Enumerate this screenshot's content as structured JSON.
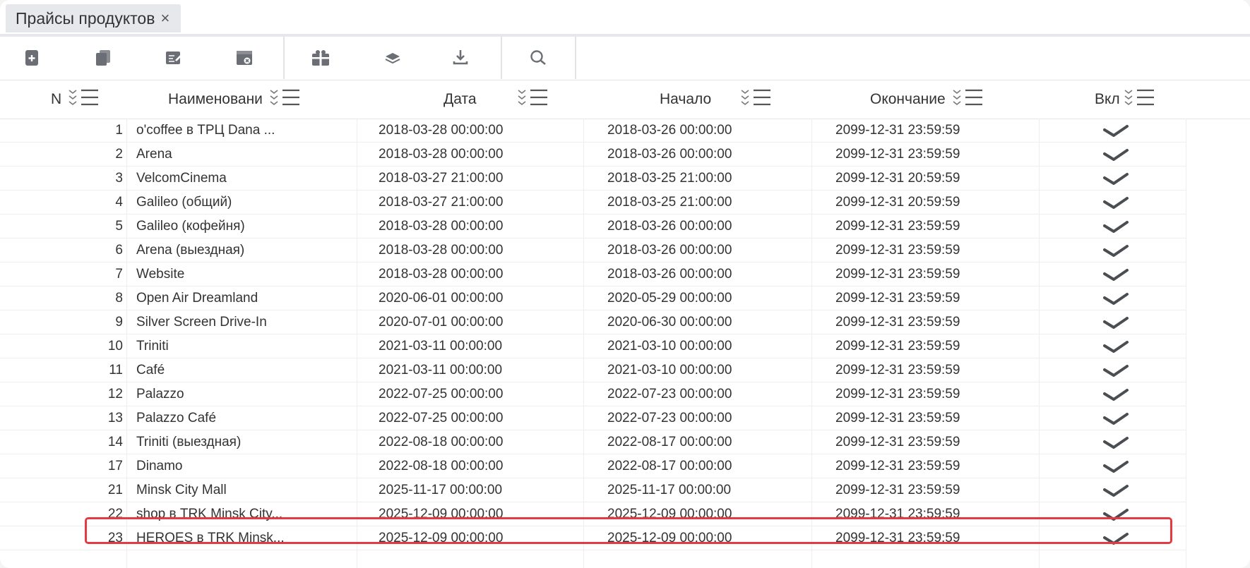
{
  "tab": {
    "title": "Прайсы продуктов",
    "close": "×"
  },
  "toolbar": {
    "icons": [
      "add-document-icon",
      "copy-icon",
      "edit-icon",
      "delete-document-icon",
      "gift-icon",
      "layers-icon",
      "download-icon",
      "search-icon"
    ]
  },
  "columns": {
    "n": "N",
    "name": "Наименовани",
    "date": "Дата",
    "start": "Начало",
    "end": "Окончание",
    "enabled": "Вкл"
  },
  "rows": [
    {
      "n": "1",
      "name": "o'coffee в ТРЦ Dana ...",
      "date": "2018-03-28 00:00:00",
      "start": "2018-03-26 00:00:00",
      "end": "2099-12-31 23:59:59",
      "enabled": true
    },
    {
      "n": "2",
      "name": "Arena",
      "date": "2018-03-28 00:00:00",
      "start": "2018-03-26 00:00:00",
      "end": "2099-12-31 23:59:59",
      "enabled": true
    },
    {
      "n": "3",
      "name": "VelcomCinema",
      "date": "2018-03-27 21:00:00",
      "start": "2018-03-25 21:00:00",
      "end": "2099-12-31 20:59:59",
      "enabled": true
    },
    {
      "n": "4",
      "name": "Galileo (общий)",
      "date": "2018-03-27 21:00:00",
      "start": "2018-03-25 21:00:00",
      "end": "2099-12-31 20:59:59",
      "enabled": true
    },
    {
      "n": "5",
      "name": "Galileo (кофейня)",
      "date": "2018-03-28 00:00:00",
      "start": "2018-03-26 00:00:00",
      "end": "2099-12-31 23:59:59",
      "enabled": true
    },
    {
      "n": "6",
      "name": "Arena (выездная)",
      "date": "2018-03-28 00:00:00",
      "start": "2018-03-26 00:00:00",
      "end": "2099-12-31 23:59:59",
      "enabled": true
    },
    {
      "n": "7",
      "name": "Website",
      "date": "2018-03-28 00:00:00",
      "start": "2018-03-26 00:00:00",
      "end": "2099-12-31 23:59:59",
      "enabled": true
    },
    {
      "n": "8",
      "name": "Open Air Dreamland",
      "date": "2020-06-01 00:00:00",
      "start": "2020-05-29 00:00:00",
      "end": "2099-12-31 23:59:59",
      "enabled": true
    },
    {
      "n": "9",
      "name": "Silver Screen Drive-In",
      "date": "2020-07-01 00:00:00",
      "start": "2020-06-30 00:00:00",
      "end": "2099-12-31 23:59:59",
      "enabled": true
    },
    {
      "n": "10",
      "name": "Triniti",
      "date": "2021-03-11 00:00:00",
      "start": "2021-03-10 00:00:00",
      "end": "2099-12-31 23:59:59",
      "enabled": true
    },
    {
      "n": "11",
      "name": "Café",
      "date": "2021-03-11 00:00:00",
      "start": "2021-03-10 00:00:00",
      "end": "2099-12-31 23:59:59",
      "enabled": true
    },
    {
      "n": "12",
      "name": "Palazzo",
      "date": "2022-07-25 00:00:00",
      "start": "2022-07-23 00:00:00",
      "end": "2099-12-31 23:59:59",
      "enabled": true
    },
    {
      "n": "13",
      "name": "Palazzo Café",
      "date": "2022-07-25 00:00:00",
      "start": "2022-07-23 00:00:00",
      "end": "2099-12-31 23:59:59",
      "enabled": true
    },
    {
      "n": "14",
      "name": "Triniti (выездная)",
      "date": "2022-08-18 00:00:00",
      "start": "2022-08-17 00:00:00",
      "end": "2099-12-31 23:59:59",
      "enabled": true
    },
    {
      "n": "17",
      "name": "Dinamo",
      "date": "2022-08-18 00:00:00",
      "start": "2022-08-17 00:00:00",
      "end": "2099-12-31 23:59:59",
      "enabled": true
    },
    {
      "n": "21",
      "name": "Minsk City Mall",
      "date": "2025-11-17 00:00:00",
      "start": "2025-11-17 00:00:00",
      "end": "2099-12-31 23:59:59",
      "enabled": true
    },
    {
      "n": "22",
      "name": "shop в TRK Minsk City...",
      "date": "2025-12-09 00:00:00",
      "start": "2025-12-09 00:00:00",
      "end": "2099-12-31 23:59:59",
      "enabled": true
    },
    {
      "n": "23",
      "name": "HEROES в TRK Minsk...",
      "date": "2025-12-09 00:00:00",
      "start": "2025-12-09 00:00:00",
      "end": "2099-12-31 23:59:59",
      "enabled": true
    }
  ],
  "colors": {
    "highlight": "#e23b44",
    "icon": "#6b6f75"
  }
}
